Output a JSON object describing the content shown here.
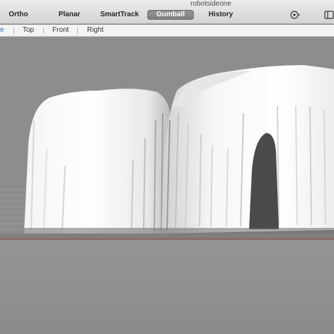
{
  "window": {
    "title": "robotsideone"
  },
  "toolbar": {
    "items": [
      {
        "label": "Ortho"
      },
      {
        "label": "Planar"
      },
      {
        "label": "SmartTrack"
      },
      {
        "label": "Gumball",
        "active": true
      },
      {
        "label": "History"
      }
    ],
    "icons": [
      "record-history-icon",
      "panel-toggle-icon"
    ]
  },
  "viewport_tabs": [
    {
      "label": "e",
      "active": true
    },
    {
      "label": "Top"
    },
    {
      "label": "Front"
    },
    {
      "label": "Right"
    }
  ],
  "colors": {
    "viewport_background": "#8d8d8d",
    "active_tab": "#2a72c8",
    "active_toolbar_item": "#8a8a8a",
    "x_axis": "#b23a3a"
  }
}
